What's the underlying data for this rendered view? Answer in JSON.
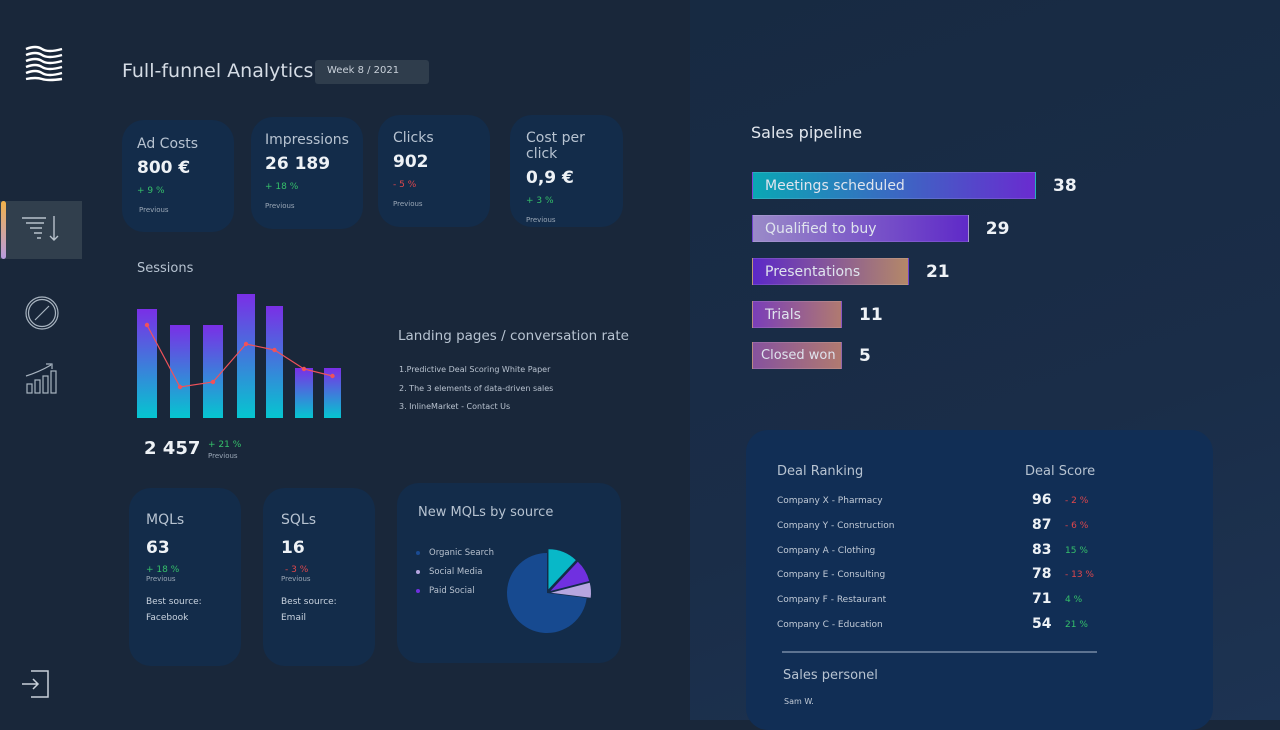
{
  "header": {
    "title": "Full-funnel Analytics",
    "week": "Week 8 / 2021"
  },
  "sidebar": {
    "items": [
      {
        "icon": "funnel-sort-icon",
        "active": true
      },
      {
        "icon": "compass-icon"
      },
      {
        "icon": "growth-chart-icon"
      }
    ],
    "logout_icon": "logout-icon",
    "logo_icon": "wave-logo-icon",
    "active_indicator_colors": [
      "#f2b24a",
      "#b79be0"
    ]
  },
  "kpis": [
    {
      "title": "Ad Costs",
      "value": "800 €",
      "change": "+ 9 %",
      "trend": "up",
      "note": "Previous"
    },
    {
      "title": "Impressions",
      "value": "26 189",
      "change": "+ 18 %",
      "trend": "up",
      "note": "Previous"
    },
    {
      "title": "Clicks",
      "value": "902",
      "change": "- 5 %",
      "trend": "down",
      "note": "Previous"
    },
    {
      "title": "Cost per click",
      "value": "0,9 €",
      "change": "+ 3 %",
      "trend": "up",
      "note": "Previous"
    }
  ],
  "sessions": {
    "title": "Sessions",
    "total": "2 457",
    "change": "+ 21 %",
    "note": "Previous"
  },
  "landing": {
    "title": "Landing pages / conversation rate",
    "items": [
      "1.Predictive Deal Scoring White Paper",
      "2. The 3 elements of data-driven sales",
      "3. InlineMarket - Contact Us"
    ]
  },
  "mqls": {
    "title": "MQLs",
    "value": "63",
    "change": "+ 18 %",
    "note": "Previous",
    "best_label": "Best source:",
    "best": "Facebook"
  },
  "sqls": {
    "title": "SQLs",
    "value": "16",
    "change": "- 3 %",
    "note": "Previous",
    "best_label": "Best source:",
    "best": "Email"
  },
  "mql_source": {
    "title": "New MQLs by source",
    "legend": [
      {
        "label": "Organic Search",
        "color": "#1a4b92"
      },
      {
        "label": "Social Media",
        "color": "#b6a6e0"
      },
      {
        "label": "Paid Social",
        "color": "#7030e0"
      }
    ]
  },
  "pipeline": {
    "title": "Sales pipeline",
    "stages": [
      {
        "label": "Meetings scheduled",
        "value": 38,
        "gradient": [
          "#0aa7b4",
          "#6a2bd0"
        ]
      },
      {
        "label": "Qualified to buy",
        "value": 29,
        "gradient": [
          "#9a8ac8",
          "#5f2ac8"
        ]
      },
      {
        "label": "Presentations",
        "value": 21,
        "gradient": [
          "#5b28c8",
          "#b48868"
        ]
      },
      {
        "label": "Trials",
        "value": 11,
        "gradient": [
          "#7a3eb8",
          "#b07a70"
        ]
      },
      {
        "label": "Closed won",
        "value": 5,
        "gradient": [
          "#86529e",
          "#b07a70"
        ]
      }
    ]
  },
  "ranking": {
    "title": "Deal Ranking",
    "score_title": "Deal Score",
    "rows": [
      {
        "name": "Company X - Pharmacy",
        "score": "96",
        "change": "- 2 %",
        "trend": "down"
      },
      {
        "name": "Company Y - Construction",
        "score": "87",
        "change": "- 6 %",
        "trend": "down"
      },
      {
        "name": "Company A - Clothing",
        "score": "83",
        "change": "15 %",
        "trend": "up"
      },
      {
        "name": "Company E - Consulting",
        "score": "78",
        "change": "- 13 %",
        "trend": "down"
      },
      {
        "name": "Company F - Restaurant",
        "score": "71",
        "change": "4 %",
        "trend": "up"
      },
      {
        "name": "Company C - Education",
        "score": "54",
        "change": "21 %",
        "trend": "up"
      }
    ],
    "personel_title": "Sales personel",
    "personel": [
      "Sam W."
    ]
  },
  "chart_data": [
    {
      "type": "bar",
      "title": "Sessions",
      "bars": [
        109,
        93,
        93,
        124,
        112,
        50,
        50
      ],
      "line": [
        93,
        31,
        36,
        74,
        68,
        49,
        42
      ],
      "bar_gradient": [
        "#7a2fe6",
        "#05c6d0"
      ],
      "line_color": "#f0525a",
      "axes": false,
      "grid": false
    },
    {
      "type": "pie",
      "title": "New MQLs by source",
      "slices": [
        {
          "label": "Organic Search",
          "value": 73,
          "color": "#174a90"
        },
        {
          "label": "",
          "value": 12,
          "color": "#08b8c8"
        },
        {
          "label": "Paid Social",
          "value": 9,
          "color": "#7030e0"
        },
        {
          "label": "Social Media",
          "value": 6,
          "color": "#b6a6e0"
        }
      ],
      "legend": "left"
    }
  ]
}
